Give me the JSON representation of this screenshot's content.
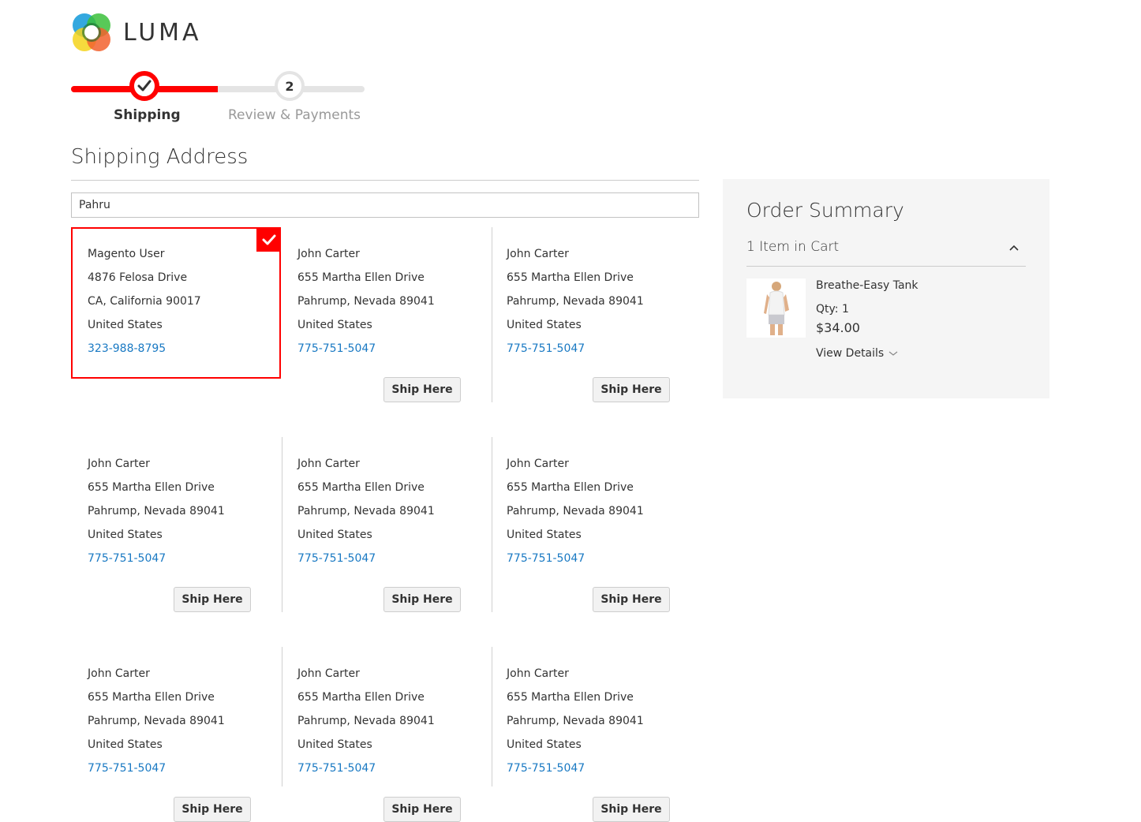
{
  "brand": {
    "name": "LUMA"
  },
  "progress": {
    "steps": [
      {
        "label": "Shipping",
        "state": "complete"
      },
      {
        "label": "Review & Payments",
        "number": "2",
        "state": "pending"
      }
    ]
  },
  "shipping": {
    "title": "Shipping Address",
    "search_value": "Pahru",
    "ship_button_label": "Ship Here",
    "addresses": [
      {
        "name": "Magento User",
        "street": "4876 Felosa Drive",
        "city": "CA, California 90017",
        "country": "United States",
        "phone": "323-988-8795",
        "selected": true
      },
      {
        "name": "John Carter",
        "street": "655 Martha Ellen Drive",
        "city": "Pahrump, Nevada 89041",
        "country": "United States",
        "phone": "775-751-5047"
      },
      {
        "name": "John Carter",
        "street": "655 Martha Ellen Drive",
        "city": "Pahrump, Nevada 89041",
        "country": "United States",
        "phone": "775-751-5047"
      },
      {
        "name": "John Carter",
        "street": "655 Martha Ellen Drive",
        "city": "Pahrump, Nevada 89041",
        "country": "United States",
        "phone": "775-751-5047"
      },
      {
        "name": "John Carter",
        "street": "655 Martha Ellen Drive",
        "city": "Pahrump, Nevada 89041",
        "country": "United States",
        "phone": "775-751-5047"
      },
      {
        "name": "John Carter",
        "street": "655 Martha Ellen Drive",
        "city": "Pahrump, Nevada 89041",
        "country": "United States",
        "phone": "775-751-5047"
      },
      {
        "name": "John Carter",
        "street": "655 Martha Ellen Drive",
        "city": "Pahrump, Nevada 89041",
        "country": "United States",
        "phone": "775-751-5047"
      },
      {
        "name": "John Carter",
        "street": "655 Martha Ellen Drive",
        "city": "Pahrump, Nevada 89041",
        "country": "United States",
        "phone": "775-751-5047"
      },
      {
        "name": "John Carter",
        "street": "655 Martha Ellen Drive",
        "city": "Pahrump, Nevada 89041",
        "country": "United States",
        "phone": "775-751-5047"
      }
    ]
  },
  "summary": {
    "title": "Order Summary",
    "cart_count": "1 Item in Cart",
    "item": {
      "name": "Breathe-Easy Tank",
      "qty": "Qty: 1",
      "price": "$34.00",
      "details_label": "View Details"
    }
  },
  "colors": {
    "accent": "#ff0000",
    "link": "#1979c3",
    "summary_bg": "#f5f5f5"
  }
}
